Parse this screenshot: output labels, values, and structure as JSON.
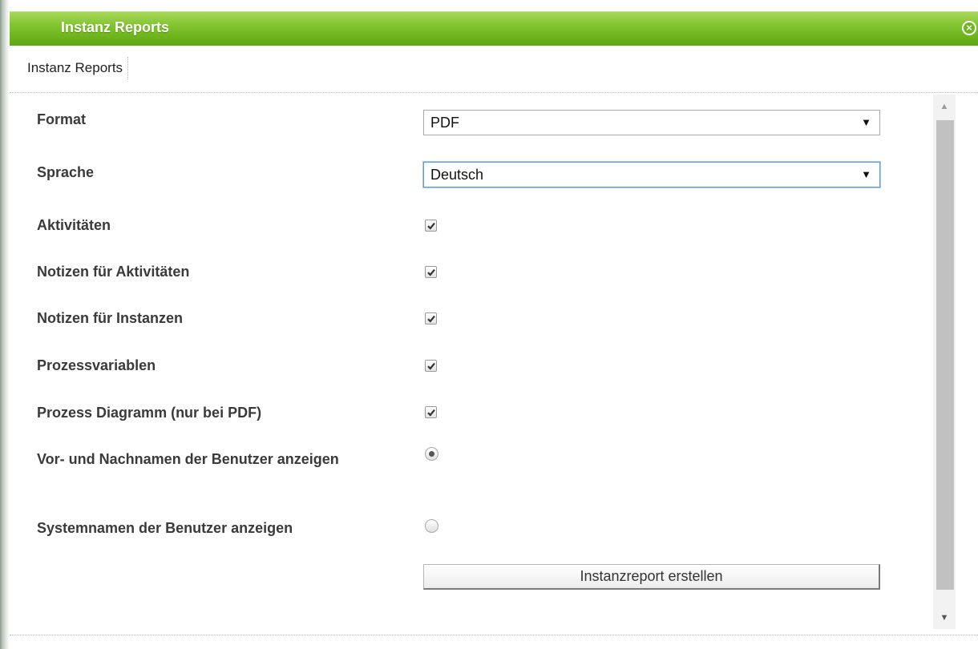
{
  "dialog": {
    "title": "Instanz Reports",
    "close_icon": "close-circle-icon"
  },
  "tabs": [
    {
      "label": "Instanz Reports",
      "active": true
    }
  ],
  "form": {
    "format": {
      "label": "Format",
      "value": "PDF"
    },
    "language": {
      "label": "Sprache",
      "value": "Deutsch"
    },
    "checkboxes": [
      {
        "label": "Aktivitäten",
        "checked": true
      },
      {
        "label": "Notizen für Aktivitäten",
        "checked": true
      },
      {
        "label": "Notizen für Instanzen",
        "checked": true
      },
      {
        "label": "Prozessvariablen",
        "checked": true
      },
      {
        "label": "Prozess Diagramm (nur bei PDF)",
        "checked": true
      }
    ],
    "radios": [
      {
        "label": "Vor- und Nachnamen der Benutzer anzeigen",
        "selected": true
      },
      {
        "label": "Systemnamen der Benutzer anzeigen",
        "selected": false
      }
    ],
    "submit_label": "Instanzreport erstellen"
  },
  "colors": {
    "titlebar_green": "#6fb51e",
    "label_text": "#3a3a3a"
  }
}
